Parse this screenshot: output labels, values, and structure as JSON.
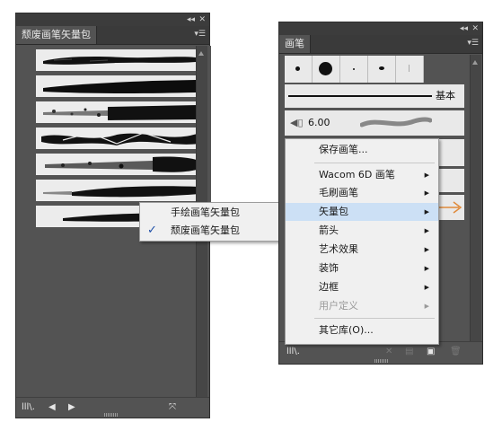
{
  "left_panel": {
    "tab_title": "颓废画笔矢量包",
    "collapse_icon": "double-chevron-icon",
    "close_icon": "close-icon",
    "menu_icon": "panel-menu-icon",
    "brush_count": 7
  },
  "right_panel": {
    "tab_title": "画笔",
    "basic_label": "基本",
    "size_value": "6.00",
    "dot_sizes": [
      "small",
      "large",
      "tiny",
      "small",
      "tiny"
    ]
  },
  "context_menu": {
    "items": [
      {
        "label": "保存画笔...",
        "has_submenu": false,
        "enabled": true
      },
      {
        "label": "Wacom 6D 画笔",
        "has_submenu": true,
        "enabled": true
      },
      {
        "label": "毛刷画笔",
        "has_submenu": true,
        "enabled": true
      },
      {
        "label": "矢量包",
        "has_submenu": true,
        "enabled": true,
        "highlighted": true
      },
      {
        "label": "箭头",
        "has_submenu": true,
        "enabled": true
      },
      {
        "label": "艺术效果",
        "has_submenu": true,
        "enabled": true
      },
      {
        "label": "装饰",
        "has_submenu": true,
        "enabled": true
      },
      {
        "label": "边框",
        "has_submenu": true,
        "enabled": true
      },
      {
        "label": "用户定义",
        "has_submenu": true,
        "enabled": false
      },
      {
        "label": "其它库(O)...",
        "has_submenu": false,
        "enabled": true
      }
    ]
  },
  "submenu": {
    "items": [
      {
        "label": "手绘画笔矢量包",
        "checked": false
      },
      {
        "label": "颓废画笔矢量包",
        "checked": true
      }
    ]
  },
  "colors": {
    "panel_bg": "#535353",
    "menu_bg": "#f0f0f0",
    "highlight": "#cce0f5",
    "check": "#1f4fa8",
    "disabled": "#9a9a9a",
    "orange_stroke": "#e08a3a"
  }
}
